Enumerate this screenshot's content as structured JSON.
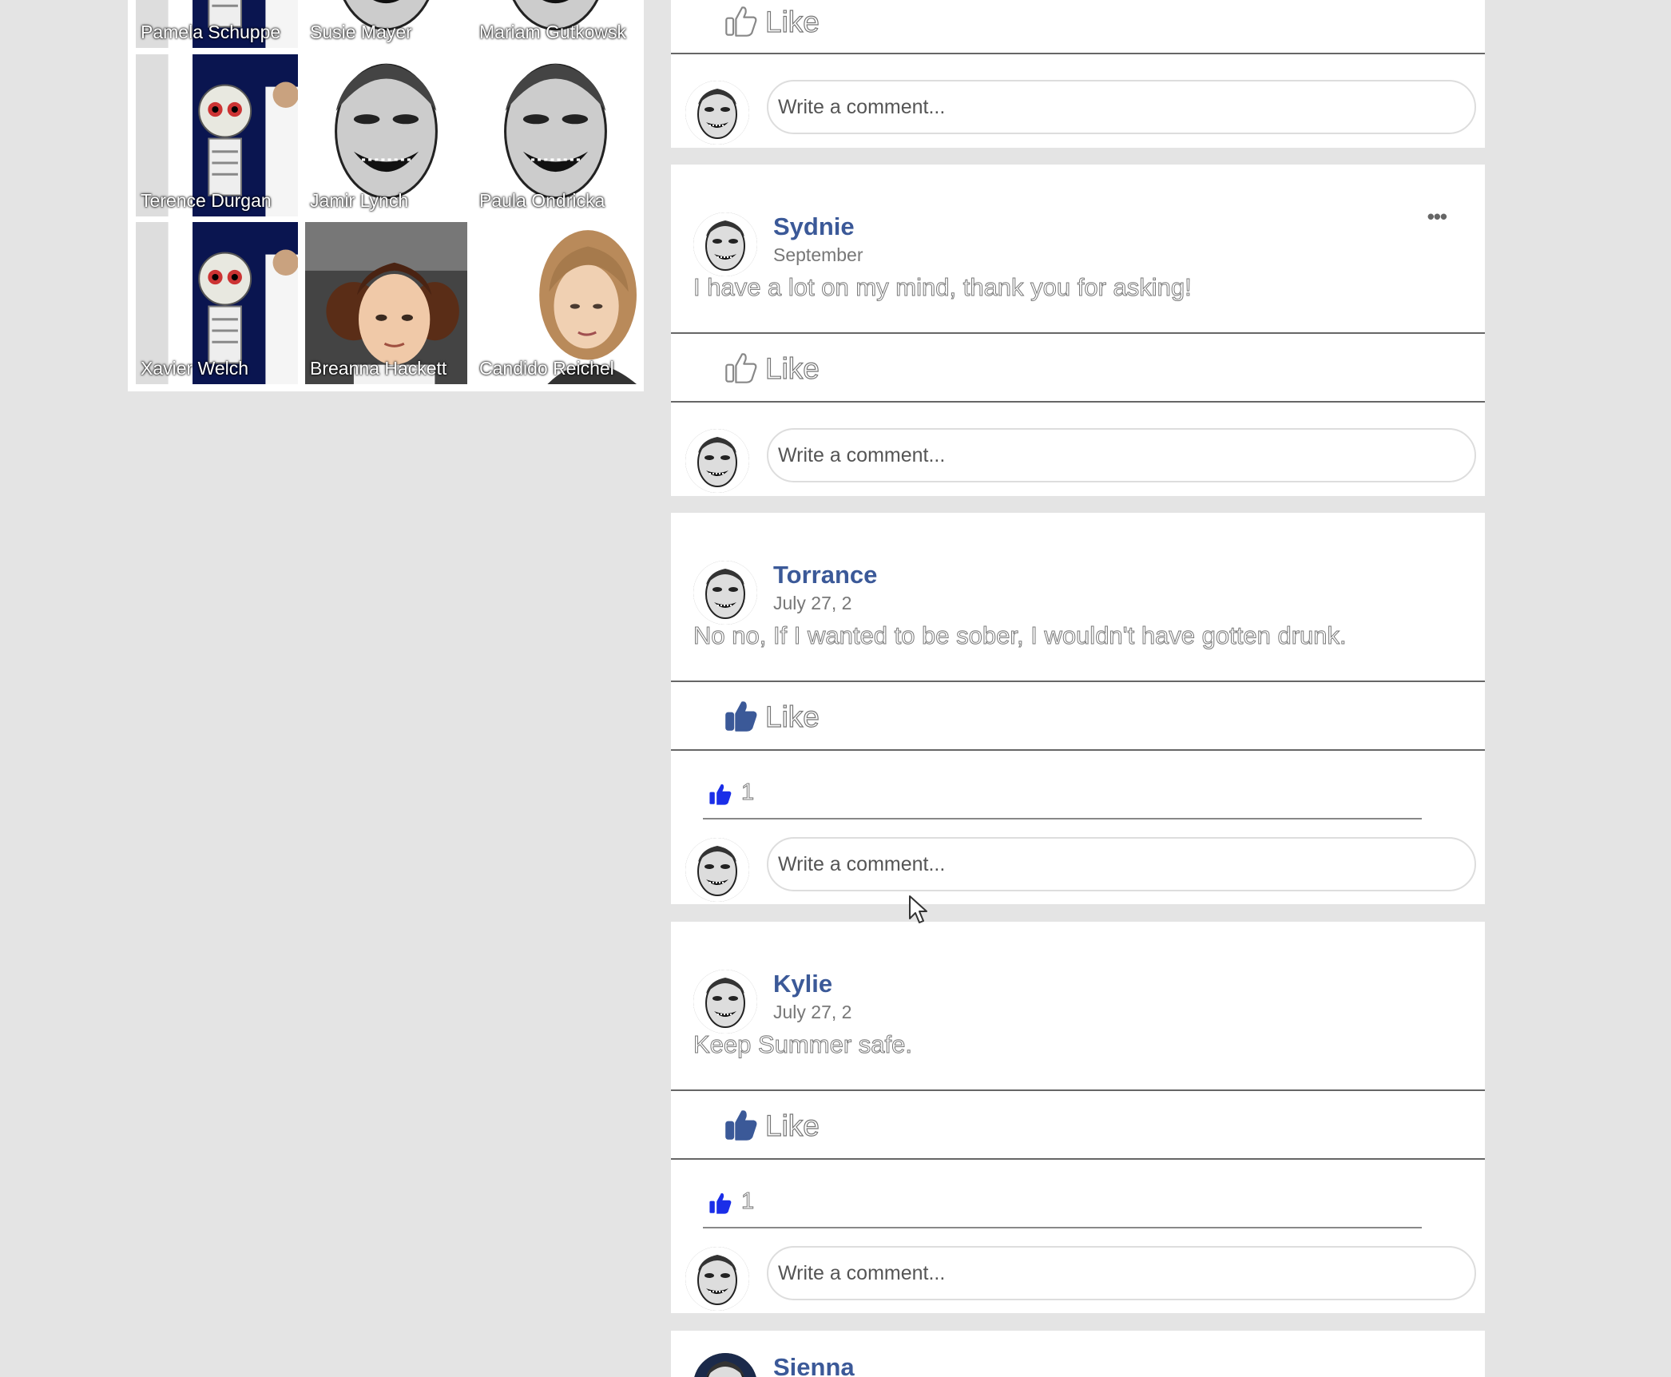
{
  "friends": [
    {
      "name": "Pamela Schuppe",
      "photo": "puppet"
    },
    {
      "name": "Susie Mayer",
      "photo": "mask"
    },
    {
      "name": "Mariam Gutkowsk",
      "photo": "mask"
    },
    {
      "name": "Terence Durgan",
      "photo": "puppet"
    },
    {
      "name": "Jamir Lynch",
      "photo": "mask"
    },
    {
      "name": "Paula Ondricka",
      "photo": "mask"
    },
    {
      "name": "Xavier Welch",
      "photo": "puppet"
    },
    {
      "name": "Breanna Hackett",
      "photo": "portrait-dark"
    },
    {
      "name": "Candido Reichel",
      "photo": "portrait-blonde"
    }
  ],
  "posts": [
    {
      "partial": "top",
      "like_label": "Like",
      "liked": false,
      "comment_placeholder": "Write a comment..."
    },
    {
      "author": "Sydnie",
      "timestamp": "September",
      "text": "I have a lot on my mind, thank you for asking!",
      "like_label": "Like",
      "liked": false,
      "show_menu": true,
      "menu_icon": "more-dots-icon",
      "comment_placeholder": "Write a comment..."
    },
    {
      "author": "Torrance",
      "timestamp": "July 27, 2",
      "text": "No no, If I wanted to be sober, I wouldn't have gotten drunk.",
      "like_label": "Like",
      "liked": true,
      "like_count": "1",
      "comment_placeholder": "Write a comment..."
    },
    {
      "author": "Kylie",
      "timestamp": "July 27, 2",
      "text": "Keep Summer safe.",
      "like_label": "Like",
      "liked": true,
      "like_count": "1",
      "comment_placeholder": "Write a comment..."
    },
    {
      "author": "Sienna",
      "partial": "bottom"
    }
  ],
  "colors": {
    "accent": "#3b5998",
    "like_blue": "#1a2ee8",
    "background": "#e4e4e4"
  }
}
